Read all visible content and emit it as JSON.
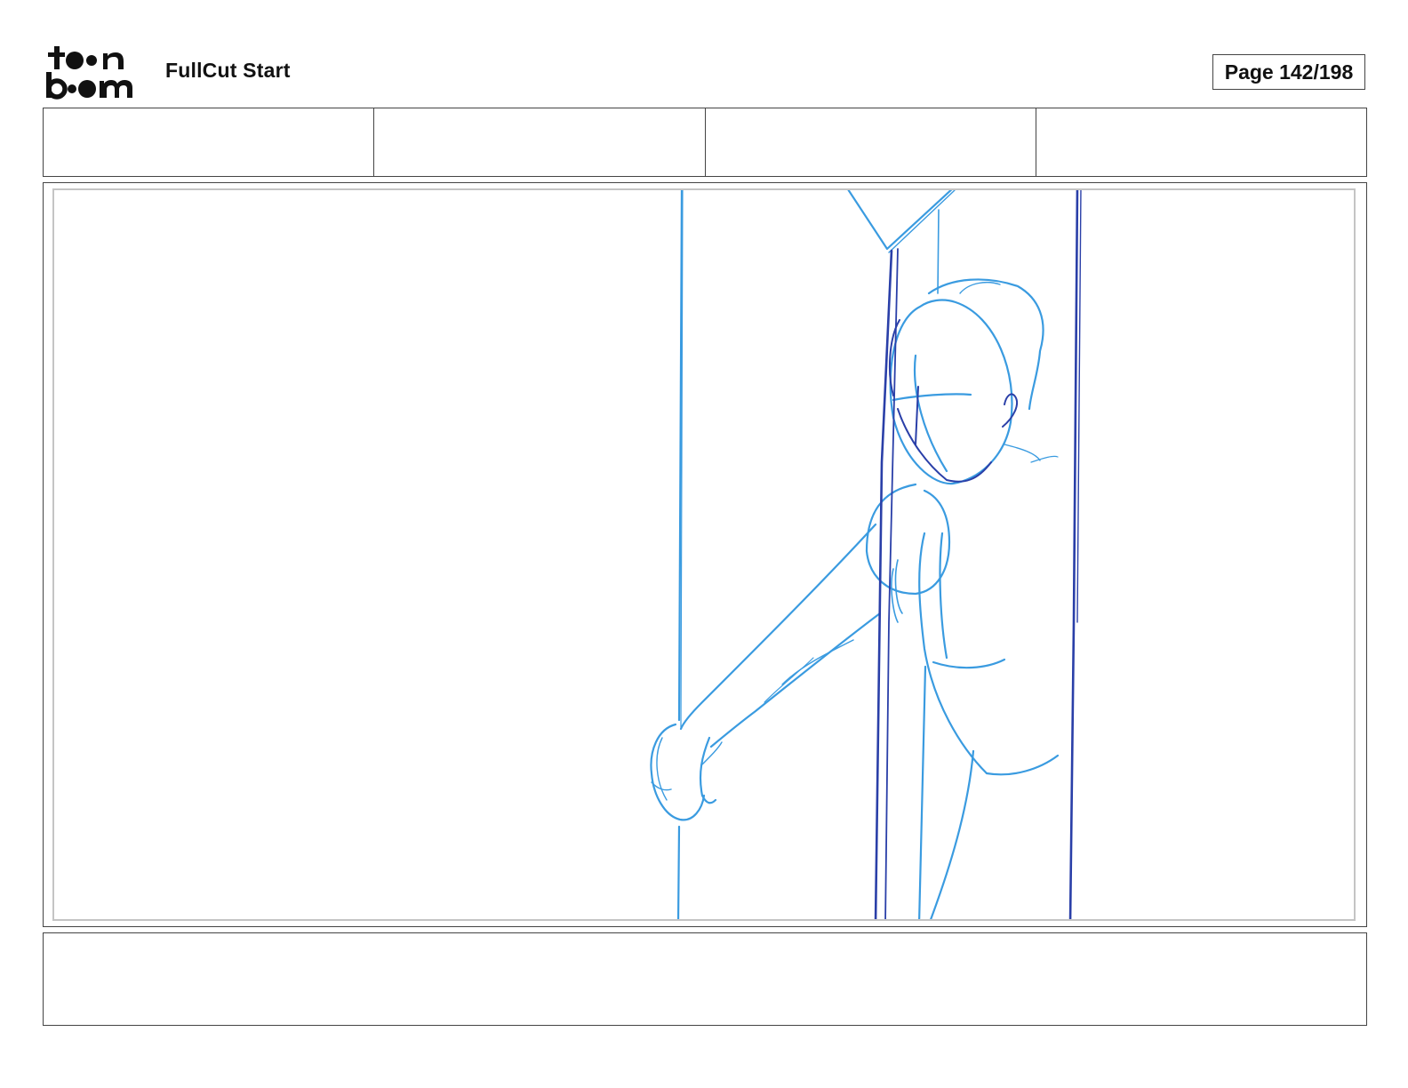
{
  "header": {
    "logo_text": "toon boom",
    "project_title": "FullCut Start",
    "page_indicator": "Page 142/198"
  },
  "header_fields": [
    "",
    "",
    "",
    ""
  ],
  "panel": {
    "sketch_colors": {
      "light_blue": "#3a9be0",
      "dark_blue": "#2a3fa8"
    }
  },
  "caption": {
    "text": ""
  }
}
